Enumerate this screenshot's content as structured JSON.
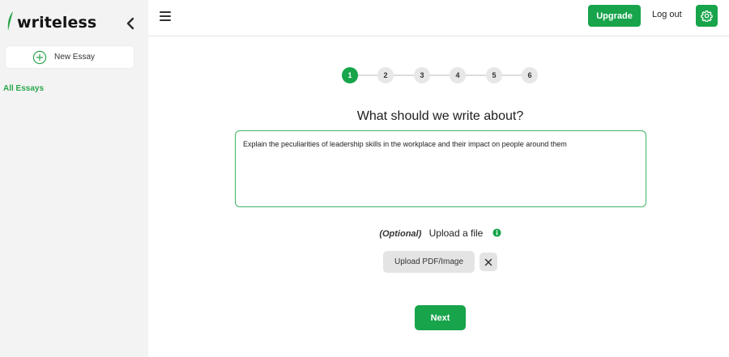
{
  "brand": {
    "name": "writeless",
    "accent": "#17a44a"
  },
  "sidebar": {
    "new_essay_label": "New Essay",
    "all_essays_label": "All Essays"
  },
  "topbar": {
    "upgrade_label": "Upgrade",
    "logout_label": "Log out"
  },
  "stepper": {
    "steps": [
      "1",
      "2",
      "3",
      "4",
      "5",
      "6"
    ],
    "current": 1
  },
  "main": {
    "question": "What should we write about?",
    "essay_prompt_value": "Explain the peculiarities of leadership skills in the workplace and their impact on people around them",
    "optional_label": "(Optional)",
    "upload_label": "Upload a file",
    "upload_button_label": "Upload PDF/Image",
    "next_label": "Next"
  },
  "icons": {
    "collapse": "chevron-left-icon",
    "menu": "hamburger-menu-icon",
    "settings": "gear-icon",
    "new_essay": "plus-circle-icon",
    "info": "info-icon",
    "clear": "close-icon"
  }
}
